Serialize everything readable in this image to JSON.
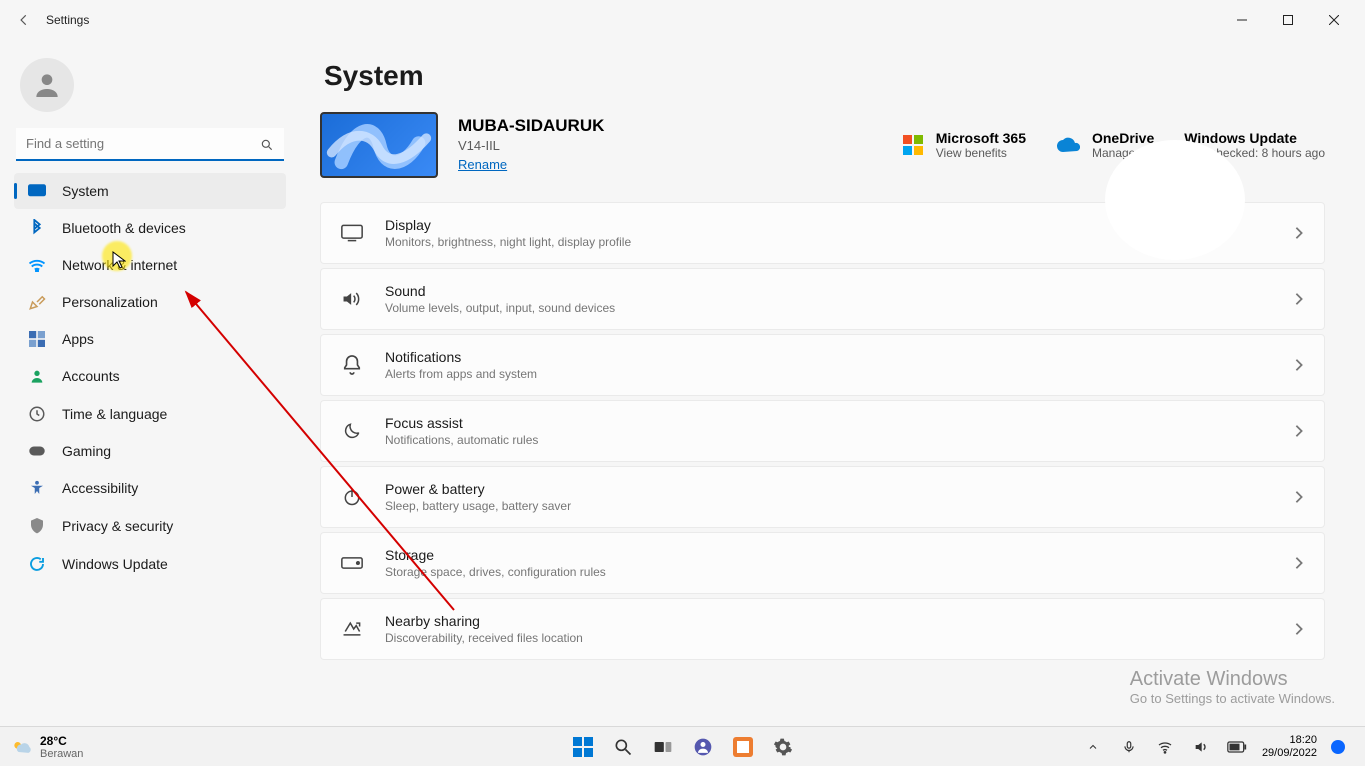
{
  "window": {
    "title": "Settings"
  },
  "user": {
    "name": ""
  },
  "search": {
    "placeholder": "Find a setting"
  },
  "nav": [
    {
      "key": "system",
      "label": "System",
      "iconColor": "#0067c0"
    },
    {
      "key": "bluetooth",
      "label": "Bluetooth & devices",
      "iconColor": "#0067c0"
    },
    {
      "key": "network",
      "label": "Network & internet",
      "iconColor": "#0094ff"
    },
    {
      "key": "personalization",
      "label": "Personalization",
      "iconColor": "#c99b5a"
    },
    {
      "key": "apps",
      "label": "Apps",
      "iconColor": "#3b6db3"
    },
    {
      "key": "accounts",
      "label": "Accounts",
      "iconColor": "#1ba260"
    },
    {
      "key": "time",
      "label": "Time & language",
      "iconColor": "#5a5a5a"
    },
    {
      "key": "gaming",
      "label": "Gaming",
      "iconColor": "#5a5a5a"
    },
    {
      "key": "accessibility",
      "label": "Accessibility",
      "iconColor": "#3b6db3"
    },
    {
      "key": "privacy",
      "label": "Privacy & security",
      "iconColor": "#8a8a8a"
    },
    {
      "key": "update",
      "label": "Windows Update",
      "iconColor": "#0a9de0"
    }
  ],
  "page": {
    "title": "System"
  },
  "device": {
    "name": "MUBA-SIDAURUK",
    "model": "V14-IIL",
    "rename": "Rename"
  },
  "heroCards": {
    "m365": {
      "title": "Microsoft 365",
      "sub": "View benefits"
    },
    "onedrive": {
      "title": "OneDrive",
      "sub": "Manage"
    },
    "update": {
      "title": "Windows Update",
      "sub": "Last checked: 8 hours ago"
    }
  },
  "items": [
    {
      "key": "display",
      "title": "Display",
      "desc": "Monitors, brightness, night light, display profile"
    },
    {
      "key": "sound",
      "title": "Sound",
      "desc": "Volume levels, output, input, sound devices"
    },
    {
      "key": "notifications",
      "title": "Notifications",
      "desc": "Alerts from apps and system"
    },
    {
      "key": "focus",
      "title": "Focus assist",
      "desc": "Notifications, automatic rules"
    },
    {
      "key": "power",
      "title": "Power & battery",
      "desc": "Sleep, battery usage, battery saver"
    },
    {
      "key": "storage",
      "title": "Storage",
      "desc": "Storage space, drives, configuration rules"
    },
    {
      "key": "nearby",
      "title": "Nearby sharing",
      "desc": "Discoverability, received files location"
    }
  ],
  "watermark": {
    "line1": "Activate Windows",
    "line2": "Go to Settings to activate Windows."
  },
  "taskbar": {
    "weather": {
      "temp": "28°C",
      "cond": "Berawan"
    },
    "time": "18:20",
    "date": "29/09/2022"
  }
}
